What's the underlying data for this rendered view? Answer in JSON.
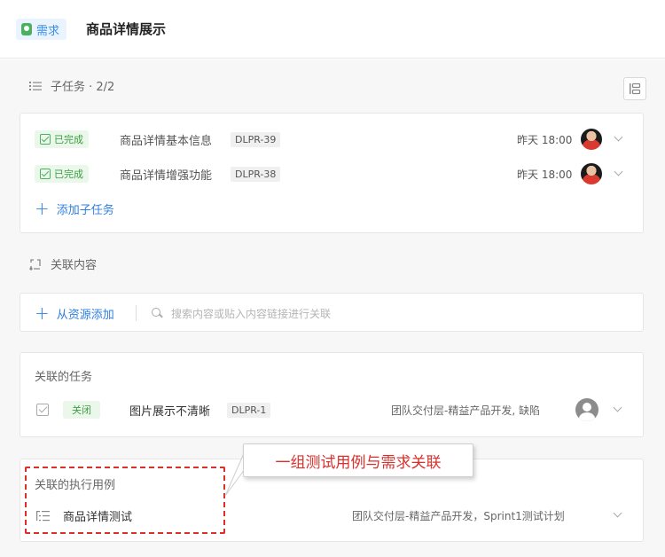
{
  "header": {
    "type_tag": "需求",
    "title": "商品详情展示"
  },
  "subtasks": {
    "title": "子任务 · 2/2",
    "items": [
      {
        "status": "已完成",
        "name": "商品详情基本信息",
        "code": "DLPR-39",
        "time": "昨天 18:00"
      },
      {
        "status": "已完成",
        "name": "商品详情增强功能",
        "code": "DLPR-38",
        "time": "昨天 18:00"
      }
    ],
    "add_label": "添加子任务"
  },
  "related": {
    "title": "关联内容",
    "add_from_resource": "从资源添加",
    "search_placeholder": "搜索内容或贴入内容链接进行关联"
  },
  "related_tasks": {
    "title": "关联的任务",
    "items": [
      {
        "status": "关闭",
        "name": "图片展示不清晰",
        "code": "DLPR-1",
        "project": "团队交付层-精益产品开发, 缺陷"
      }
    ]
  },
  "related_cases": {
    "title": "关联的执行用例",
    "items": [
      {
        "name": "商品详情测试",
        "project": "团队交付层-精益产品开发，Sprint1测试计划"
      }
    ]
  },
  "annotation": {
    "callout_text": "一组测试用例与需求关联",
    "accent_color": "#d9302c"
  },
  "colors": {
    "primary": "#2f7fe0",
    "success": "#3c9f43",
    "background": "#f7f7f7"
  }
}
